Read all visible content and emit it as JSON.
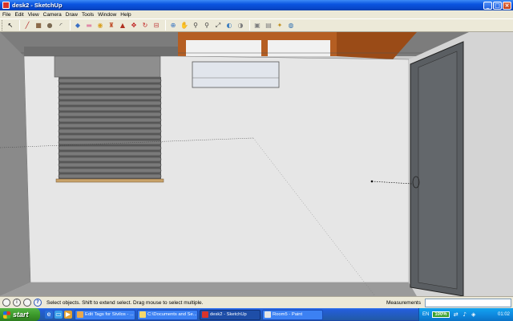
{
  "window": {
    "title": "desk2 - SketchUp",
    "min_glyph": "_",
    "max_glyph": "□",
    "close_glyph": "×"
  },
  "menu": [
    "File",
    "Edit",
    "View",
    "Camera",
    "Draw",
    "Tools",
    "Window",
    "Help"
  ],
  "toolbar": {
    "tools": [
      {
        "name": "select-tool",
        "glyph": "↖",
        "color": "#000000"
      },
      {
        "name": "line-tool",
        "glyph": "╱",
        "color": "#b02020"
      },
      {
        "name": "rectangle-tool",
        "glyph": "■",
        "color": "#8c6b4a"
      },
      {
        "name": "circle-tool",
        "glyph": "●",
        "color": "#7b6a52"
      },
      {
        "name": "arc-tool",
        "glyph": "◜",
        "color": "#404040"
      },
      {
        "name": "make-component-tool",
        "glyph": "◆",
        "color": "#3a6fc4"
      },
      {
        "name": "eraser-tool",
        "glyph": "▬",
        "color": "#e08aa8"
      },
      {
        "name": "tape-measure-tool",
        "glyph": "◉",
        "color": "#d8a020"
      },
      {
        "name": "paint-bucket-tool",
        "glyph": "♜",
        "color": "#c0502c"
      },
      {
        "name": "push-pull-tool",
        "glyph": "▲",
        "color": "#b03020"
      },
      {
        "name": "move-tool",
        "glyph": "✥",
        "color": "#c02020"
      },
      {
        "name": "rotate-tool",
        "glyph": "↻",
        "color": "#c02020"
      },
      {
        "name": "offset-tool",
        "glyph": "⊟",
        "color": "#c04040"
      },
      {
        "name": "orbit-tool",
        "glyph": "⊕",
        "color": "#3070c0"
      },
      {
        "name": "pan-tool",
        "glyph": "✋",
        "color": "#707070"
      },
      {
        "name": "zoom-tool",
        "glyph": "⚲",
        "color": "#404040"
      },
      {
        "name": "zoom-window-tool",
        "glyph": "⚲",
        "color": "#404040"
      },
      {
        "name": "zoom-extents-tool",
        "glyph": "⤢",
        "color": "#404040"
      },
      {
        "name": "previous-view-tool",
        "glyph": "◐",
        "color": "#4080c0"
      },
      {
        "name": "next-view-tool",
        "glyph": "◑",
        "color": "#808080"
      },
      {
        "name": "get-models-tool",
        "glyph": "▣",
        "color": "#808080"
      },
      {
        "name": "share-model-tool",
        "glyph": "▤",
        "color": "#808080"
      },
      {
        "name": "share-component-tool",
        "glyph": "✦",
        "color": "#c09020"
      },
      {
        "name": "google-earth-tool",
        "glyph": "◍",
        "color": "#3070b0"
      }
    ]
  },
  "status": {
    "hint": "Select objects. Shift to extend select. Drag mouse to select multiple.",
    "measurements_label": "Measurements",
    "help_glyph": "?",
    "info_glyph": "i"
  },
  "taskbar": {
    "start_label": "start",
    "tasks": [
      {
        "label": "Edit Tags for Stvilos - ...",
        "color": "#e9a84c",
        "active": false
      },
      {
        "label": "C:\\Documents and Se...",
        "color": "#f5d86a",
        "active": false
      },
      {
        "label": "desk2 - SketchUp",
        "color": "#d8342a",
        "active": true
      },
      {
        "label": "Room5 - Paint",
        "color": "#e5e5e5",
        "active": false
      }
    ],
    "language": "EN",
    "battery": "100%",
    "clock": "01:02"
  }
}
